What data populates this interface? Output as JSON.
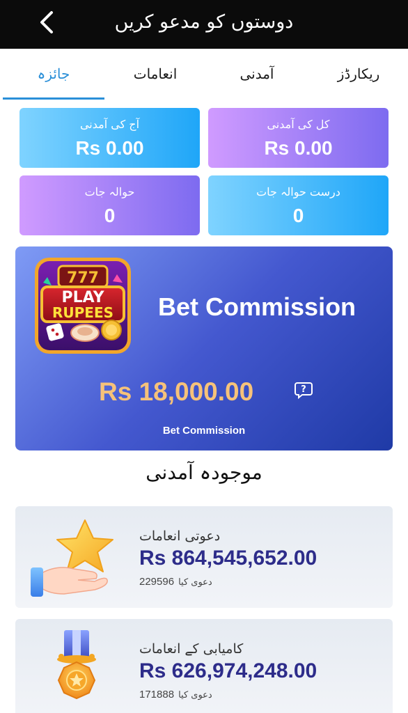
{
  "header": {
    "title": "دوستوں کو مدعو کریں"
  },
  "tabs": [
    {
      "label": "جائزہ"
    },
    {
      "label": "انعامات"
    },
    {
      "label": "آمدنی"
    },
    {
      "label": "ریکارڈز"
    }
  ],
  "stats": {
    "today_income": {
      "label": "آج کی آمدنی",
      "value": "Rs 0.00"
    },
    "total_income": {
      "label": "کل کی آمدنی",
      "value": "Rs 0.00"
    },
    "referrals": {
      "label": "حوالہ جات",
      "value": "0"
    },
    "valid_referrals": {
      "label": "درست حوالہ جات",
      "value": "0"
    }
  },
  "commission": {
    "logo_text_top": "PLAY",
    "logo_text_bottom": "RUPEES",
    "logo_slots": "777",
    "title": "Bet Commission",
    "amount": "Rs 18,000.00",
    "subtitle": "Bet Commission"
  },
  "section_title": "موجودہ آمدنی",
  "rewards": [
    {
      "title": "دعوتی انعامات",
      "amount": "Rs 864,545,652.00",
      "claimed_label": "دعوی کیا",
      "claimed_value": "229596"
    },
    {
      "title": "کامیابی کے انعامات",
      "amount": "Rs 626,974,248.00",
      "claimed_label": "دعوی کیا",
      "claimed_value": "171888"
    }
  ],
  "colors": {
    "accent": "#2a8fd8",
    "reward_amount": "#2d2c8a",
    "commission_amount": "#f6c27a"
  }
}
